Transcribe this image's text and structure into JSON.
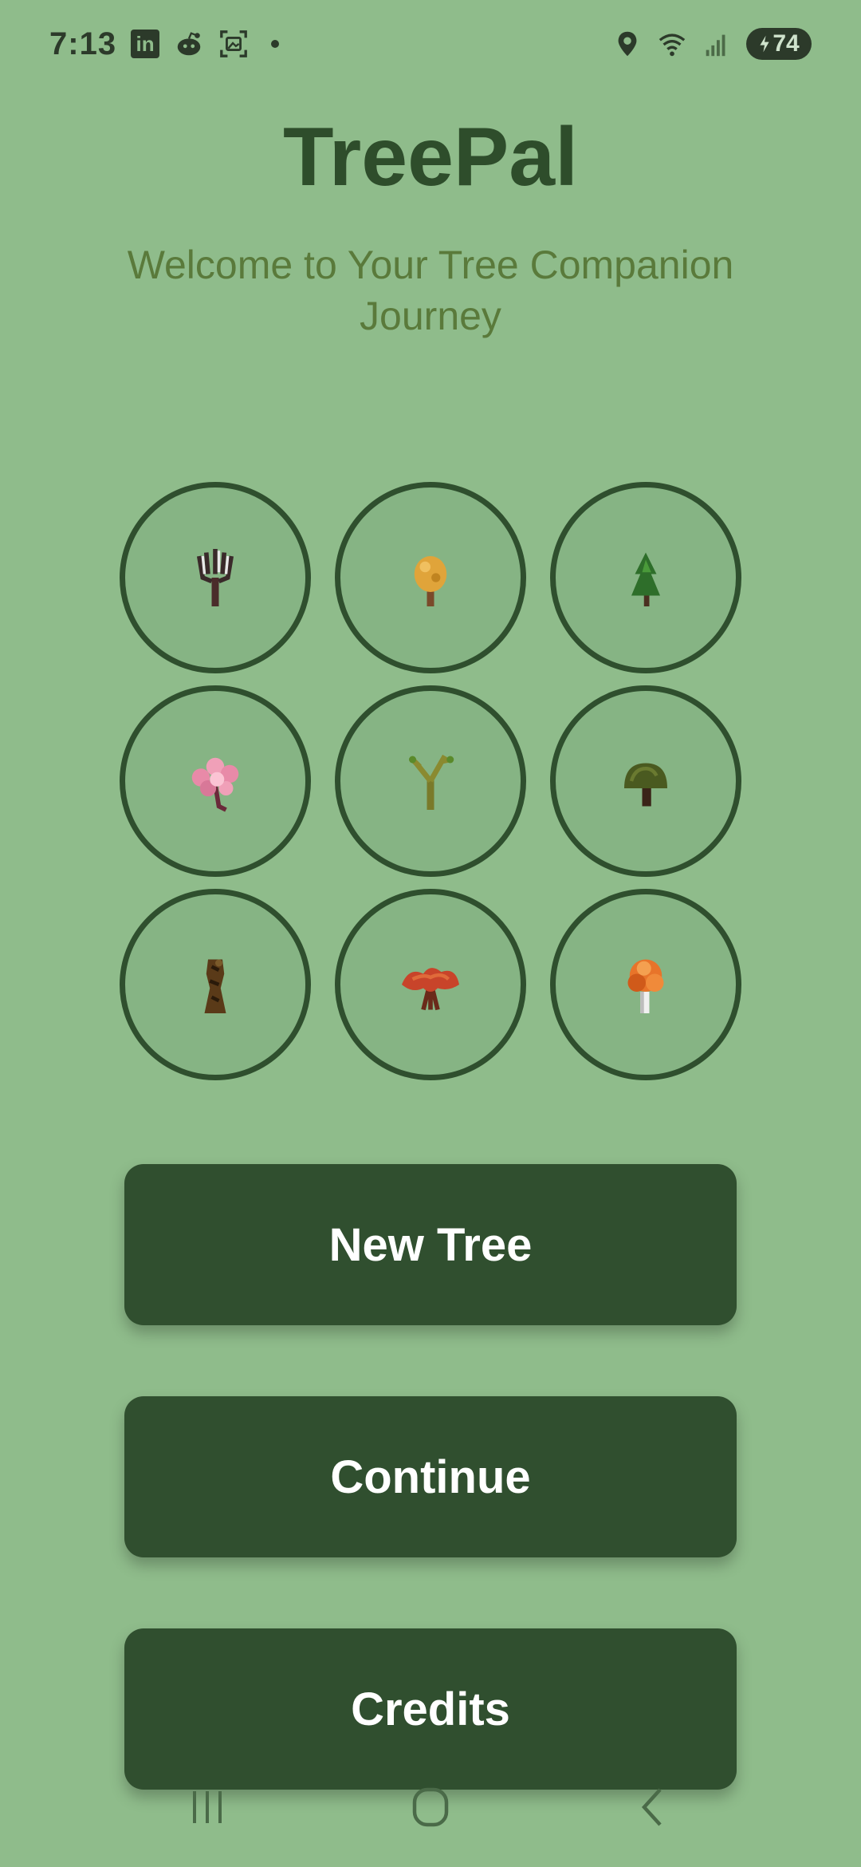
{
  "status_bar": {
    "time": "7:13",
    "linkedin_letters": "in",
    "battery_level": "74",
    "icons": [
      "linkedin-icon",
      "reddit-icon",
      "screenshot-icon",
      "notification-dot",
      "location-icon",
      "wifi-icon",
      "signal-icon",
      "battery-icon"
    ]
  },
  "app": {
    "title": "TreePal",
    "subtitle": "Welcome to Your Tree Companion Journey"
  },
  "trees": [
    {
      "name": "birch-sapling-icon"
    },
    {
      "name": "golden-sapling-icon"
    },
    {
      "name": "pine-sapling-icon"
    },
    {
      "name": "cherry-blossom-icon"
    },
    {
      "name": "young-branch-tree-icon"
    },
    {
      "name": "bonsai-tree-icon"
    },
    {
      "name": "dead-trunk-icon"
    },
    {
      "name": "red-maple-icon"
    },
    {
      "name": "autumn-tree-icon"
    }
  ],
  "buttons": {
    "new_tree": "New Tree",
    "continue": "Continue",
    "credits": "Credits"
  },
  "nav": {
    "icons": [
      "recent-apps-icon",
      "home-icon",
      "back-icon"
    ]
  },
  "colors": {
    "background": "#8fbc8b",
    "primary_dark": "#304f2f",
    "subtitle": "#5a7a3b",
    "circle_fill": "#86b484"
  }
}
